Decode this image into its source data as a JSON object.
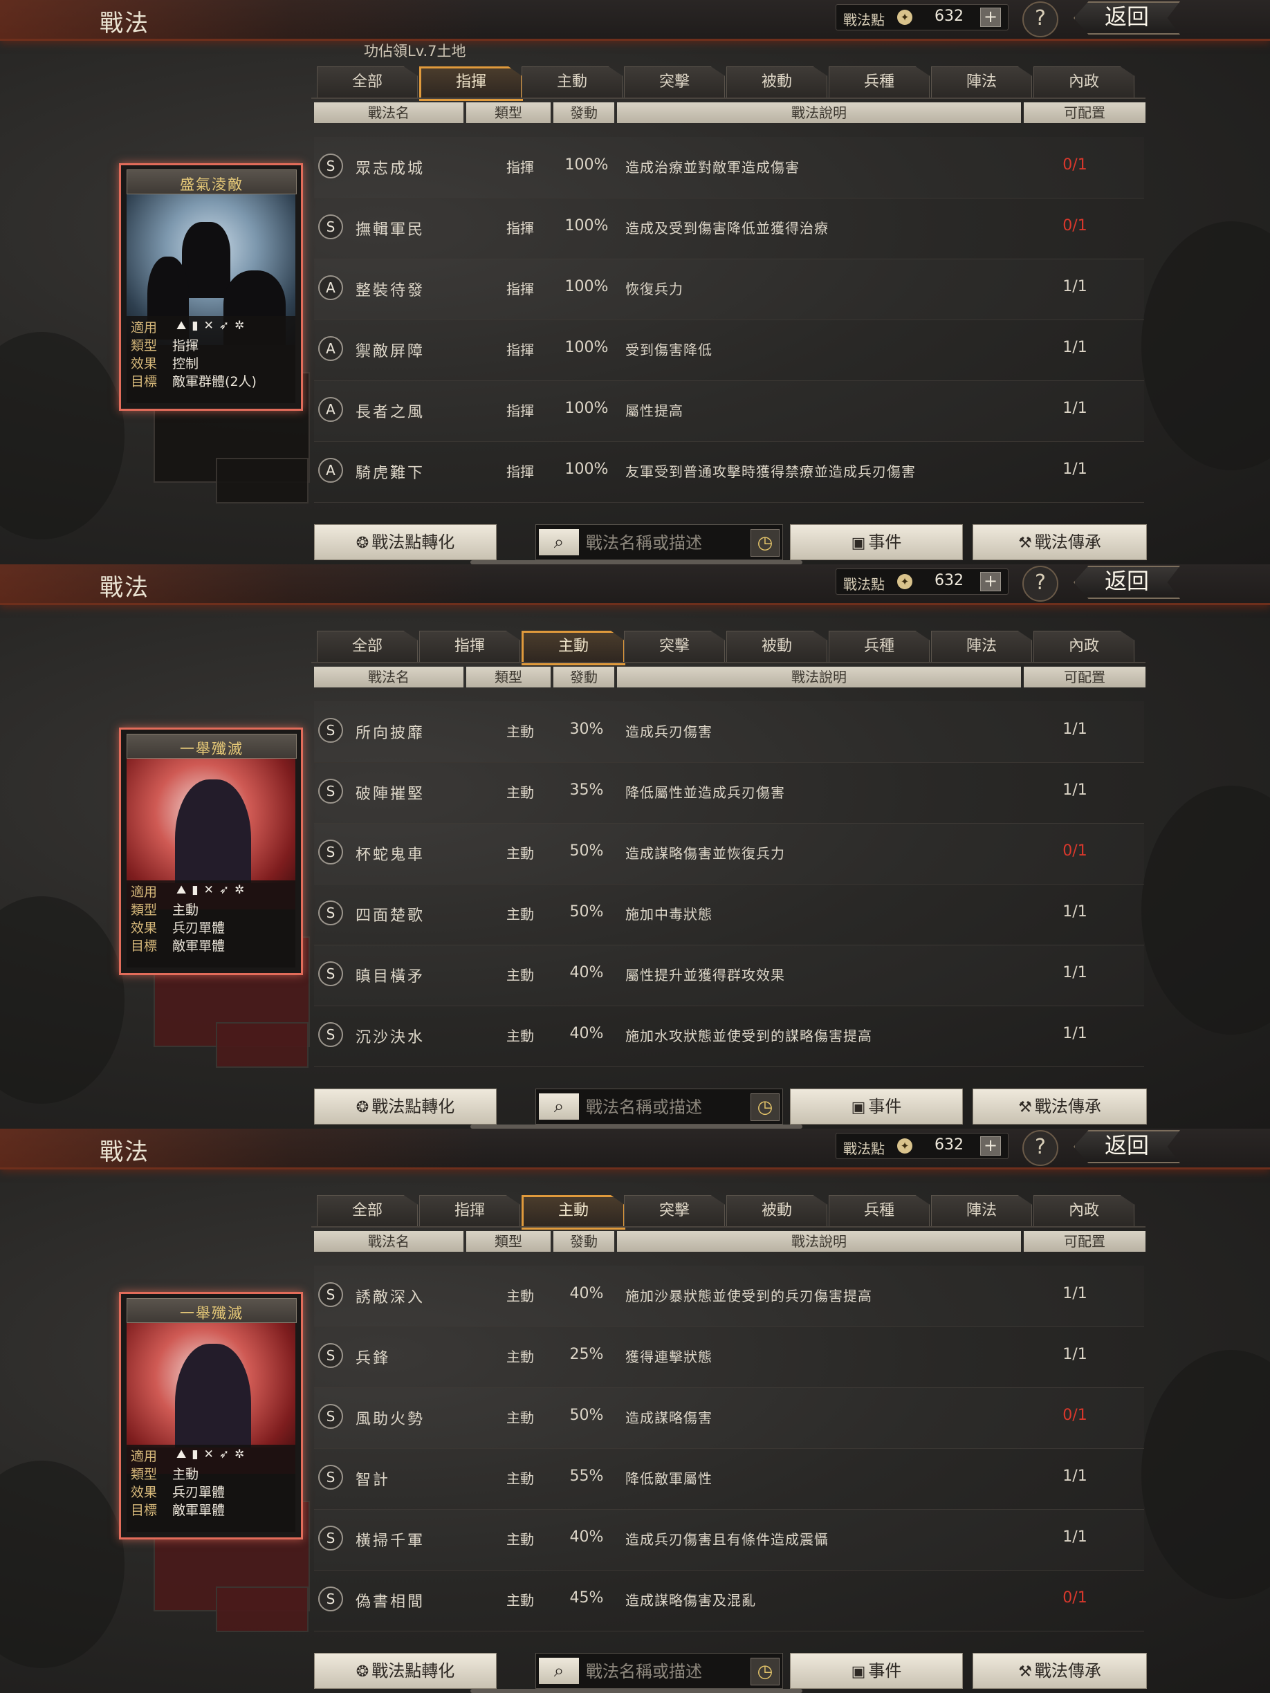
{
  "header": {
    "title": "戰法",
    "points_label": "戰法點",
    "points_value": "632",
    "plus_icon": "+",
    "help_icon": "?",
    "back_label": "返回"
  },
  "territory_text": "功佔領Lv.7土地",
  "tabs": [
    "全部",
    "指揮",
    "主動",
    "突擊",
    "被動",
    "兵種",
    "陣法",
    "內政"
  ],
  "columns": [
    "戰法名",
    "類型",
    "發動",
    "戰法說明",
    "可配置"
  ],
  "search_placeholder": "戰法名稱或描述",
  "buttons": {
    "convert": "戰法點轉化",
    "event": "事件",
    "inherit": "戰法傳承"
  },
  "card_labels": {
    "apply": "適用",
    "type": "類型",
    "effect": "效果",
    "target": "目標"
  },
  "colors": {
    "active_tab": "#e09a3c",
    "full_slot": "#d8382c",
    "card_border": "#e26c5a"
  },
  "panels": [
    {
      "active_tab": "指揮",
      "card": {
        "title": "盛氣淩敵",
        "type": "指揮",
        "effect": "控制",
        "target": "敵軍群體(2人)"
      },
      "rows": [
        {
          "grade": "S",
          "name": "眾志成城",
          "type": "指揮",
          "rate": "100%",
          "desc": "造成治療並對敵軍造成傷害",
          "slot": "0/1",
          "full": true
        },
        {
          "grade": "S",
          "name": "撫輯軍民",
          "type": "指揮",
          "rate": "100%",
          "desc": "造成及受到傷害降低並獲得治療",
          "slot": "0/1",
          "full": true
        },
        {
          "grade": "A",
          "name": "整裝待發",
          "type": "指揮",
          "rate": "100%",
          "desc": "恢復兵力",
          "slot": "1/1",
          "full": false
        },
        {
          "grade": "A",
          "name": "禦敵屏障",
          "type": "指揮",
          "rate": "100%",
          "desc": "受到傷害降低",
          "slot": "1/1",
          "full": false
        },
        {
          "grade": "A",
          "name": "長者之風",
          "type": "指揮",
          "rate": "100%",
          "desc": "屬性提高",
          "slot": "1/1",
          "full": false
        },
        {
          "grade": "A",
          "name": "騎虎難下",
          "type": "指揮",
          "rate": "100%",
          "desc": "友軍受到普通攻擊時獲得禁療並造成兵刃傷害",
          "slot": "1/1",
          "full": false
        }
      ]
    },
    {
      "active_tab": "主動",
      "card": {
        "title": "一舉殲滅",
        "type": "主動",
        "effect": "兵刃單體",
        "target": "敵軍單體"
      },
      "rows": [
        {
          "grade": "S",
          "name": "所向披靡",
          "type": "主動",
          "rate": "30%",
          "desc": "造成兵刃傷害",
          "slot": "1/1",
          "full": false
        },
        {
          "grade": "S",
          "name": "破陣摧堅",
          "type": "主動",
          "rate": "35%",
          "desc": "降低屬性並造成兵刃傷害",
          "slot": "1/1",
          "full": false
        },
        {
          "grade": "S",
          "name": "杯蛇鬼車",
          "type": "主動",
          "rate": "50%",
          "desc": "造成謀略傷害並恢復兵力",
          "slot": "0/1",
          "full": true
        },
        {
          "grade": "S",
          "name": "四面楚歌",
          "type": "主動",
          "rate": "50%",
          "desc": "施加中毒狀態",
          "slot": "1/1",
          "full": false
        },
        {
          "grade": "S",
          "name": "瞋目橫矛",
          "type": "主動",
          "rate": "40%",
          "desc": "屬性提升並獲得群攻效果",
          "slot": "1/1",
          "full": false
        },
        {
          "grade": "S",
          "name": "沉沙決水",
          "type": "主動",
          "rate": "40%",
          "desc": "施加水攻狀態並使受到的謀略傷害提高",
          "slot": "1/1",
          "full": false
        }
      ]
    },
    {
      "active_tab": "主動",
      "card": {
        "title": "一舉殲滅",
        "type": "主動",
        "effect": "兵刃單體",
        "target": "敵軍單體"
      },
      "rows": [
        {
          "grade": "S",
          "name": "誘敵深入",
          "type": "主動",
          "rate": "40%",
          "desc": "施加沙暴狀態並使受到的兵刃傷害提高",
          "slot": "1/1",
          "full": false
        },
        {
          "grade": "S",
          "name": "兵鋒",
          "type": "主動",
          "rate": "25%",
          "desc": "獲得連擊狀態",
          "slot": "1/1",
          "full": false
        },
        {
          "grade": "S",
          "name": "風助火勢",
          "type": "主動",
          "rate": "50%",
          "desc": "造成謀略傷害",
          "slot": "0/1",
          "full": true
        },
        {
          "grade": "S",
          "name": "智計",
          "type": "主動",
          "rate": "55%",
          "desc": "降低敵軍屬性",
          "slot": "1/1",
          "full": false
        },
        {
          "grade": "S",
          "name": "橫掃千軍",
          "type": "主動",
          "rate": "40%",
          "desc": "造成兵刃傷害且有條件造成震懾",
          "slot": "1/1",
          "full": false
        },
        {
          "grade": "S",
          "name": "偽書相間",
          "type": "主動",
          "rate": "45%",
          "desc": "造成謀略傷害及混亂",
          "slot": "0/1",
          "full": true
        }
      ]
    }
  ]
}
